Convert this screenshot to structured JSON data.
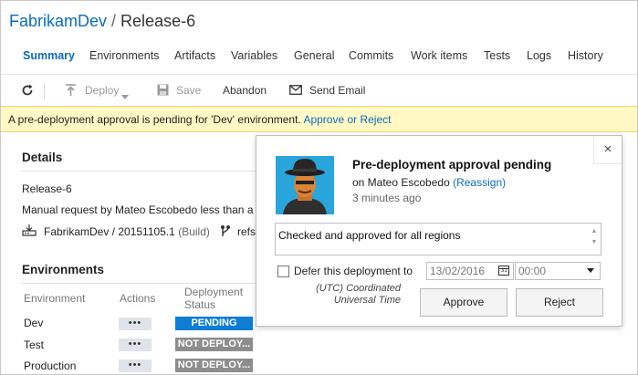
{
  "header": {
    "project": "FabrikamDev",
    "separator": "/",
    "release": "Release-6"
  },
  "tabs": [
    {
      "label": "Summary",
      "active": true
    },
    {
      "label": "Environments"
    },
    {
      "label": "Artifacts"
    },
    {
      "label": "Variables"
    },
    {
      "label": "General"
    },
    {
      "label": "Commits"
    },
    {
      "label": "Work items"
    },
    {
      "label": "Tests"
    },
    {
      "label": "Logs"
    },
    {
      "label": "History"
    }
  ],
  "toolbar": {
    "deploy_label": "Deploy",
    "save_label": "Save",
    "abandon_label": "Abandon",
    "send_email_label": "Send Email"
  },
  "banner": {
    "message": "A pre-deployment approval is pending for 'Dev' environment.",
    "link": "Approve or Reject"
  },
  "details": {
    "title": "Details",
    "release_name": "Release-6",
    "manual_request": "Manual request by Mateo Escobedo less than a r",
    "artifact": "FabrikamDev / 20151105.1",
    "artifact_type": "(Build)",
    "branch": "refs"
  },
  "environments": {
    "title": "Environments",
    "headers": {
      "environment": "Environment",
      "actions": "Actions",
      "status": "Deployment Status"
    },
    "rows": [
      {
        "name": "Dev",
        "actions": "•••",
        "status": "PENDING",
        "status_kind": "pending"
      },
      {
        "name": "Test",
        "actions": "•••",
        "status": "NOT DEPLOY...",
        "status_kind": "notdeployed"
      },
      {
        "name": "Production",
        "actions": "•••",
        "status": "NOT DEPLOY...",
        "status_kind": "notdeployed"
      }
    ]
  },
  "approval_popup": {
    "title": "Pre-deployment approval pending",
    "on_text": "on Mateo Escobedo",
    "reassign": "(Reassign)",
    "time": "3 minutes ago",
    "comment": "Checked and approved for all regions",
    "defer_label": "Defer this deployment to",
    "defer_checked": false,
    "defer_date": "13/02/2016",
    "calendar_day": "31",
    "defer_time": "00:00",
    "timezone": "(UTC) Coordinated Universal Time",
    "approve_label": "Approve",
    "reject_label": "Reject",
    "close_glyph": "×"
  },
  "colors": {
    "accent": "#0a6bbf",
    "banner_bg": "#fff8c4",
    "pending": "#0f7dd4",
    "not_deployed": "#8d8d8d"
  }
}
